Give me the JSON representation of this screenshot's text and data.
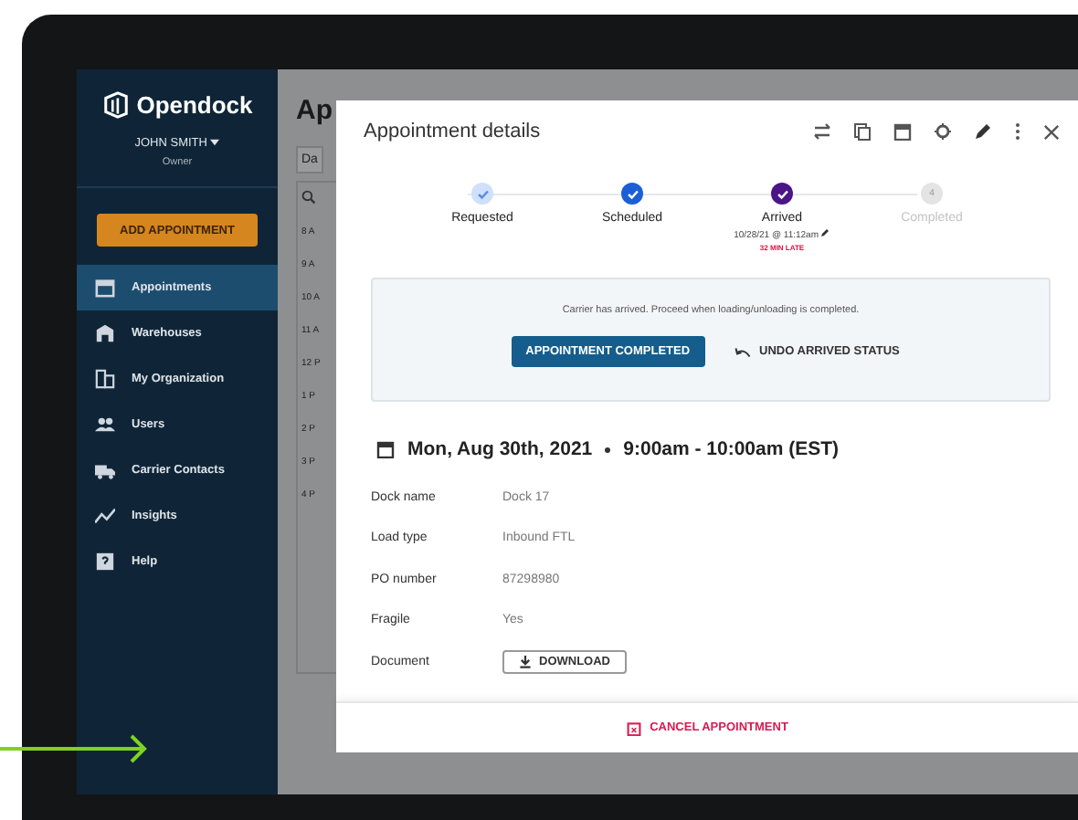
{
  "sidebar": {
    "brand": "Opendock",
    "user": {
      "name": "JOHN SMITH",
      "role": "Owner"
    },
    "add_button": "ADD APPOINTMENT",
    "items": [
      {
        "label": "Appointments",
        "selected": true
      },
      {
        "label": "Warehouses",
        "selected": false
      },
      {
        "label": "My Organization",
        "selected": false
      },
      {
        "label": "Users",
        "selected": false
      },
      {
        "label": "Carrier Contacts",
        "selected": false
      },
      {
        "label": "Insights",
        "selected": false
      },
      {
        "label": "Help",
        "selected": false
      }
    ]
  },
  "background": {
    "title": "Ap",
    "date_button": "Da",
    "times": [
      "8 A",
      "9 A",
      "10 A",
      "11 A",
      "12 P",
      "1 P",
      "2 P",
      "3 P",
      "4 P"
    ]
  },
  "modal": {
    "title": "Appointment details",
    "steps": [
      {
        "label": "Requested",
        "kind": "done",
        "color": "#cfe0fb"
      },
      {
        "label": "Scheduled",
        "kind": "done",
        "color": "#1a5fd6"
      },
      {
        "label": "Arrived",
        "kind": "done",
        "color": "#4b1589",
        "time": "10/28/21 @ 11:12am",
        "note": "32 MIN LATE"
      },
      {
        "label": "Completed",
        "kind": "pending",
        "color": "#e4e4e4",
        "number": "4"
      }
    ],
    "alert": {
      "message": "Carrier has arrived. Proceed when loading/unloading is completed.",
      "primary": "APPOINTMENT COMPLETED",
      "secondary": "UNDO ARRIVED STATUS"
    },
    "date": "Mon, Aug 30th, 2021",
    "time": "9:00am - 10:00am (EST)",
    "details": [
      {
        "label": "Dock name",
        "value": "Dock 17"
      },
      {
        "label": "Load type",
        "value": "Inbound FTL"
      },
      {
        "label": "PO number",
        "value": "87298980"
      },
      {
        "label": "Fragile",
        "value": "Yes"
      },
      {
        "label": "Document",
        "button": "DOWNLOAD"
      }
    ],
    "cancel": "CANCEL APPOINTMENT"
  }
}
